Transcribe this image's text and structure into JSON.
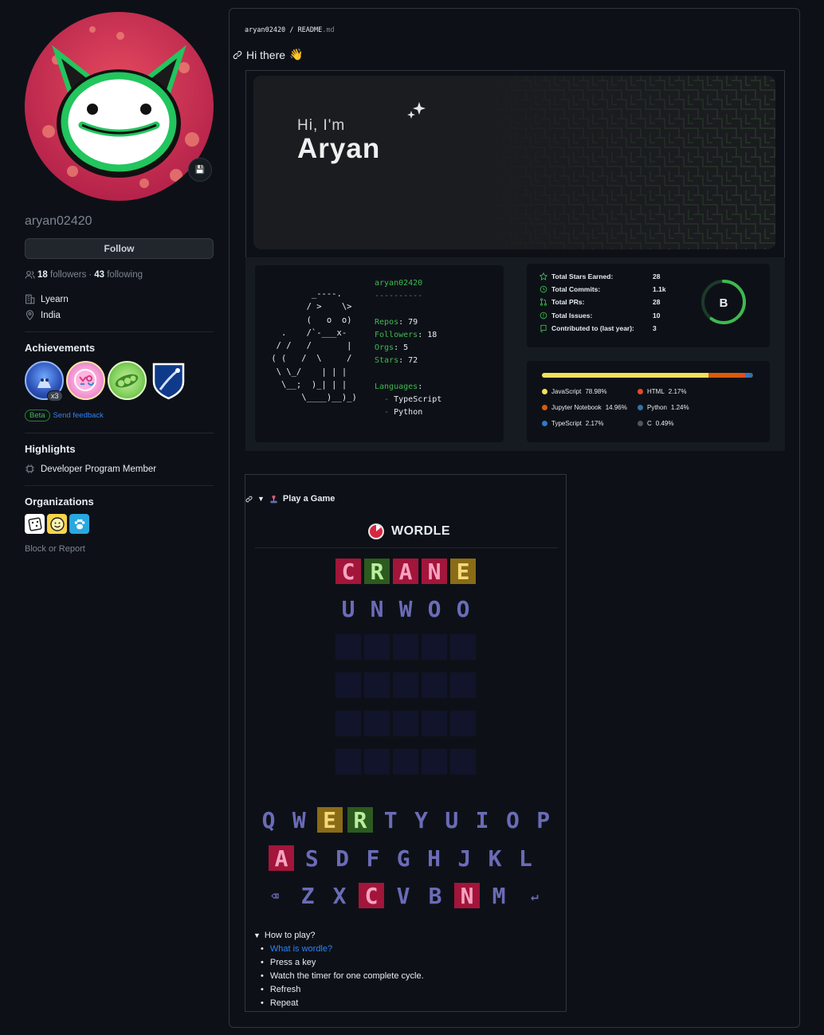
{
  "profile": {
    "username": "aryan02420",
    "follow_label": "Follow",
    "followers_count": "18",
    "followers_word": "followers",
    "sep": "·",
    "following_count": "43",
    "following_word": "following",
    "company": "Lyearn",
    "location": "India",
    "status_emoji": "💾"
  },
  "achievements": {
    "title": "Achievements",
    "multiplier": "x3",
    "beta_label": "Beta",
    "feedback_label": "Send feedback",
    "badges": [
      "shark-badge",
      "yolo-badge",
      "pair-extraordinaire-badge",
      "starstruck-badge"
    ]
  },
  "highlights": {
    "title": "Highlights",
    "item": "Developer Program Member"
  },
  "organizations": {
    "title": "Organizations"
  },
  "block_label": "Block or Report",
  "readme": {
    "crumb_user": "aryan02420",
    "crumb_sep": "/",
    "crumb_file": "README",
    "crumb_ext": ".md",
    "heading": "Hi there",
    "heading_emoji": "👋"
  },
  "hero": {
    "greeting": "Hi, I'm",
    "name": "Aryan"
  },
  "neofetch": {
    "user": "aryan02420",
    "dashes": "----------",
    "repos_label": "Repos",
    "repos_value": "79",
    "followers_label": "Followers",
    "followers_value": "18",
    "orgs_label": "Orgs",
    "orgs_value": "5",
    "stars_label": "Stars",
    "stars_value": "72",
    "languages_label": "Languages",
    "languages": [
      "TypeScript",
      "Python"
    ]
  },
  "stats": {
    "rows": [
      {
        "label": "Total Stars Earned:",
        "value": "28"
      },
      {
        "label": "Total Commits:",
        "value": "1.1k"
      },
      {
        "label": "Total PRs:",
        "value": "28"
      },
      {
        "label": "Total Issues:",
        "value": "10"
      },
      {
        "label": "Contributed to (last year):",
        "value": "3"
      }
    ],
    "rank": "B",
    "rank_progress": 0.6,
    "accent": "#3fb950"
  },
  "languages": {
    "items": [
      {
        "name": "JavaScript",
        "percent": "78.98%",
        "value": 78.98,
        "color": "#f1e05a"
      },
      {
        "name": "HTML",
        "percent": "2.17%",
        "value": 2.17,
        "color": "#e34c26"
      },
      {
        "name": "Jupyter Notebook",
        "percent": "14.96%",
        "value": 14.96,
        "color": "#da5b0b"
      },
      {
        "name": "Python",
        "percent": "1.24%",
        "value": 1.24,
        "color": "#3572a5"
      },
      {
        "name": "TypeScript",
        "percent": "2.17%",
        "value": 2.17,
        "color": "#3178c6"
      },
      {
        "name": "C",
        "percent": "0.49%",
        "value": 0.49,
        "color": "#555555"
      }
    ]
  },
  "game": {
    "summary": "Play a Game",
    "title": "WORDLE",
    "guesses": [
      {
        "letters": [
          "C",
          "R",
          "A",
          "N",
          "E"
        ],
        "states": [
          "red",
          "grn",
          "red",
          "red",
          "yel"
        ]
      },
      {
        "letters": [
          "U",
          "N",
          "W",
          "O",
          "O"
        ],
        "states": [
          "gray",
          "gray",
          "gray",
          "gray",
          "gray"
        ]
      }
    ],
    "empty_rows": 4,
    "keyboard": [
      {
        "keys": [
          "Q",
          "W",
          "E",
          "R",
          "T",
          "Y",
          "U",
          "I",
          "O",
          "P"
        ],
        "states": [
          "",
          "",
          "yel",
          "grn",
          "",
          "",
          "",
          "",
          "",
          ""
        ]
      },
      {
        "keys": [
          "A",
          "S",
          "D",
          "F",
          "G",
          "H",
          "J",
          "K",
          "L"
        ],
        "states": [
          "red",
          "",
          "",
          "",
          "",
          "",
          "",
          "",
          ""
        ]
      },
      {
        "keys": [
          "⌫",
          "Z",
          "X",
          "C",
          "V",
          "B",
          "N",
          "M",
          "↵"
        ],
        "states": [
          "",
          "",
          "",
          "red",
          "",
          "",
          "red",
          "",
          ""
        ]
      }
    ],
    "howto_title": "How to play?",
    "howto_link": "What is wordle?",
    "howto_steps": [
      "Press a key",
      "Watch the timer for one complete cycle.",
      "Refresh",
      "Repeat"
    ]
  }
}
